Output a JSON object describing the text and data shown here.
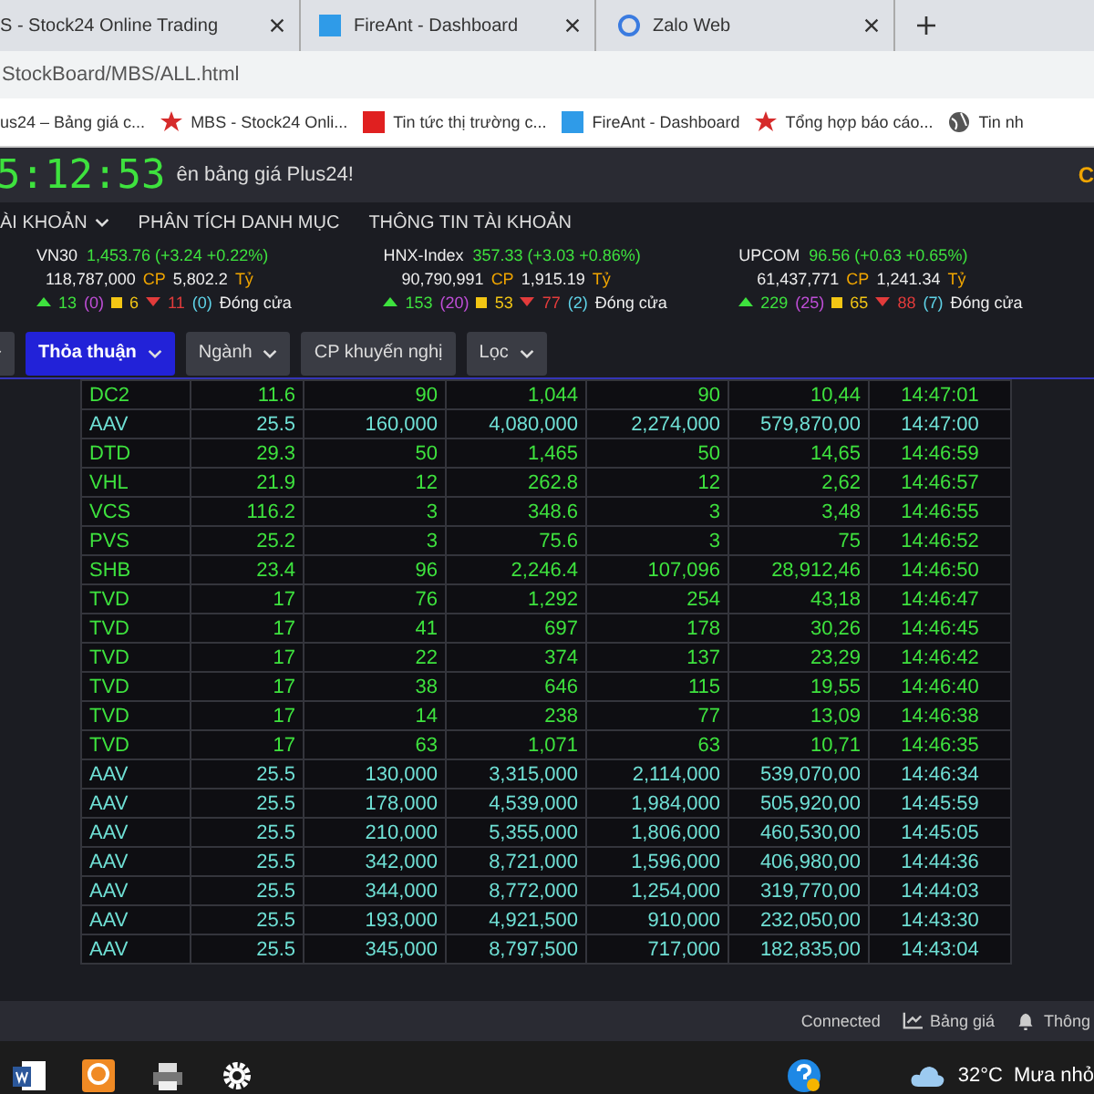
{
  "browser_tabs": [
    {
      "title": "S - Stock24 Online Trading",
      "kind": "none"
    },
    {
      "title": "FireAnt - Dashboard",
      "kind": "square"
    },
    {
      "title": "Zalo Web",
      "kind": "circle"
    }
  ],
  "address": "StockBoard/MBS/ALL.html",
  "bookmarks": [
    {
      "label": "us24 – Bảng giá c...",
      "kind": "none"
    },
    {
      "label": "MBS - Stock24 Onli...",
      "kind": "star"
    },
    {
      "label": "Tin tức thị trường c...",
      "kind": "red"
    },
    {
      "label": "FireAnt - Dashboard",
      "kind": "blue"
    },
    {
      "label": "Tổng hợp báo cáo...",
      "kind": "star"
    },
    {
      "label": "Tin nh",
      "kind": "globe"
    }
  ],
  "header": {
    "clock": "5:12:53",
    "marquee": "ên bảng giá Plus24!",
    "right_text": "C"
  },
  "menu": [
    {
      "label": "ÀI KHOẢN",
      "dropdown": true
    },
    {
      "label": "PHÂN TÍCH DANH MỤC",
      "dropdown": false
    },
    {
      "label": "THÔNG TIN TÀI KHOẢN",
      "dropdown": false
    }
  ],
  "indices": [
    {
      "name": "VN30",
      "value": "1,453.76 (+3.24 +0.22%)",
      "volume": "118,787,000",
      "volume_unit": "CP",
      "turnover": "5,802.2",
      "turnover_unit": "Tỷ",
      "up": "13",
      "ceiling": "(0)",
      "flat": "6",
      "down": "11",
      "floor": "(0)",
      "status": "Đóng cửa"
    },
    {
      "name": "HNX-Index",
      "value": "357.33 (+3.03 +0.86%)",
      "volume": "90,790,991",
      "volume_unit": "CP",
      "turnover": "1,915.19",
      "turnover_unit": "Tỷ",
      "up": "153",
      "ceiling": "(20)",
      "flat": "53",
      "down": "77",
      "floor": "(2)",
      "status": "Đóng cửa"
    },
    {
      "name": "UPCOM",
      "value": "96.56 (+0.63 +0.65%)",
      "volume": "61,437,771",
      "volume_unit": "CP",
      "turnover": "1,241.34",
      "turnover_unit": "Tỷ",
      "up": "229",
      "ceiling": "(25)",
      "flat": "65",
      "down": "88",
      "floor": "(7)",
      "status": "Đóng cửa"
    }
  ],
  "filters": [
    {
      "dropdown": true,
      "selected": false
    },
    {
      "label": "Thỏa thuận",
      "dropdown": true,
      "selected": true
    },
    {
      "label": "Ngành",
      "dropdown": true,
      "selected": false
    },
    {
      "label": "CP khuyến nghị",
      "dropdown": false,
      "selected": false
    },
    {
      "label": "Lọc",
      "dropdown": true,
      "selected": false
    }
  ],
  "table": {
    "rows": [
      {
        "color": "#3ee23e",
        "cells": [
          "DC2",
          "11.6",
          "90",
          "1,044",
          "90",
          "10,44",
          "14:47:01"
        ]
      },
      {
        "color": "#6fe0d5",
        "cells": [
          "AAV",
          "25.5",
          "160,000",
          "4,080,000",
          "2,274,000",
          "579,870,00",
          "14:47:00"
        ]
      },
      {
        "color": "#3ee23e",
        "cells": [
          "DTD",
          "29.3",
          "50",
          "1,465",
          "50",
          "14,65",
          "14:46:59"
        ]
      },
      {
        "color": "#3ee23e",
        "cells": [
          "VHL",
          "21.9",
          "12",
          "262.8",
          "12",
          "2,62",
          "14:46:57"
        ]
      },
      {
        "color": "#3ee23e",
        "cells": [
          "VCS",
          "116.2",
          "3",
          "348.6",
          "3",
          "3,48",
          "14:46:55"
        ]
      },
      {
        "color": "#3ee23e",
        "cells": [
          "PVS",
          "25.2",
          "3",
          "75.6",
          "3",
          "75",
          "14:46:52"
        ]
      },
      {
        "color": "#3ee23e",
        "cells": [
          "SHB",
          "23.4",
          "96",
          "2,246.4",
          "107,096",
          "28,912,46",
          "14:46:50"
        ]
      },
      {
        "color": "#3ee23e",
        "cells": [
          "TVD",
          "17",
          "76",
          "1,292",
          "254",
          "43,18",
          "14:46:47"
        ]
      },
      {
        "color": "#3ee23e",
        "cells": [
          "TVD",
          "17",
          "41",
          "697",
          "178",
          "30,26",
          "14:46:45"
        ]
      },
      {
        "color": "#3ee23e",
        "cells": [
          "TVD",
          "17",
          "22",
          "374",
          "137",
          "23,29",
          "14:46:42"
        ]
      },
      {
        "color": "#3ee23e",
        "cells": [
          "TVD",
          "17",
          "38",
          "646",
          "115",
          "19,55",
          "14:46:40"
        ]
      },
      {
        "color": "#3ee23e",
        "cells": [
          "TVD",
          "17",
          "14",
          "238",
          "77",
          "13,09",
          "14:46:38"
        ]
      },
      {
        "color": "#3ee23e",
        "cells": [
          "TVD",
          "17",
          "63",
          "1,071",
          "63",
          "10,71",
          "14:46:35"
        ]
      },
      {
        "color": "#6fe0d5",
        "cells": [
          "AAV",
          "25.5",
          "130,000",
          "3,315,000",
          "2,114,000",
          "539,070,00",
          "14:46:34"
        ]
      },
      {
        "color": "#6fe0d5",
        "cells": [
          "AAV",
          "25.5",
          "178,000",
          "4,539,000",
          "1,984,000",
          "505,920,00",
          "14:45:59"
        ]
      },
      {
        "color": "#6fe0d5",
        "cells": [
          "AAV",
          "25.5",
          "210,000",
          "5,355,000",
          "1,806,000",
          "460,530,00",
          "14:45:05"
        ]
      },
      {
        "color": "#6fe0d5",
        "cells": [
          "AAV",
          "25.5",
          "342,000",
          "8,721,000",
          "1,596,000",
          "406,980,00",
          "14:44:36"
        ]
      },
      {
        "color": "#6fe0d5",
        "cells": [
          "AAV",
          "25.5",
          "344,000",
          "8,772,000",
          "1,254,000",
          "319,770,00",
          "14:44:03"
        ]
      },
      {
        "color": "#6fe0d5",
        "cells": [
          "AAV",
          "25.5",
          "193,000",
          "4,921,500",
          "910,000",
          "232,050,00",
          "14:43:30"
        ]
      },
      {
        "color": "#6fe0d5",
        "cells": [
          "AAV",
          "25.5",
          "345,000",
          "8,797,500",
          "717,000",
          "182,835,00",
          "14:43:04"
        ]
      }
    ]
  },
  "status_bar": [
    {
      "label": "Connected",
      "kind": "none"
    },
    {
      "label": "Bảng giá",
      "kind": "chart"
    },
    {
      "label": "Thông",
      "kind": "bell"
    }
  ],
  "taskbar": {
    "apps": [
      {
        "kind": "word"
      },
      {
        "kind": "orange"
      },
      {
        "kind": "printer"
      },
      {
        "kind": "gear"
      }
    ],
    "temperature": "32°C",
    "weather": "Mưa nhỏ"
  }
}
